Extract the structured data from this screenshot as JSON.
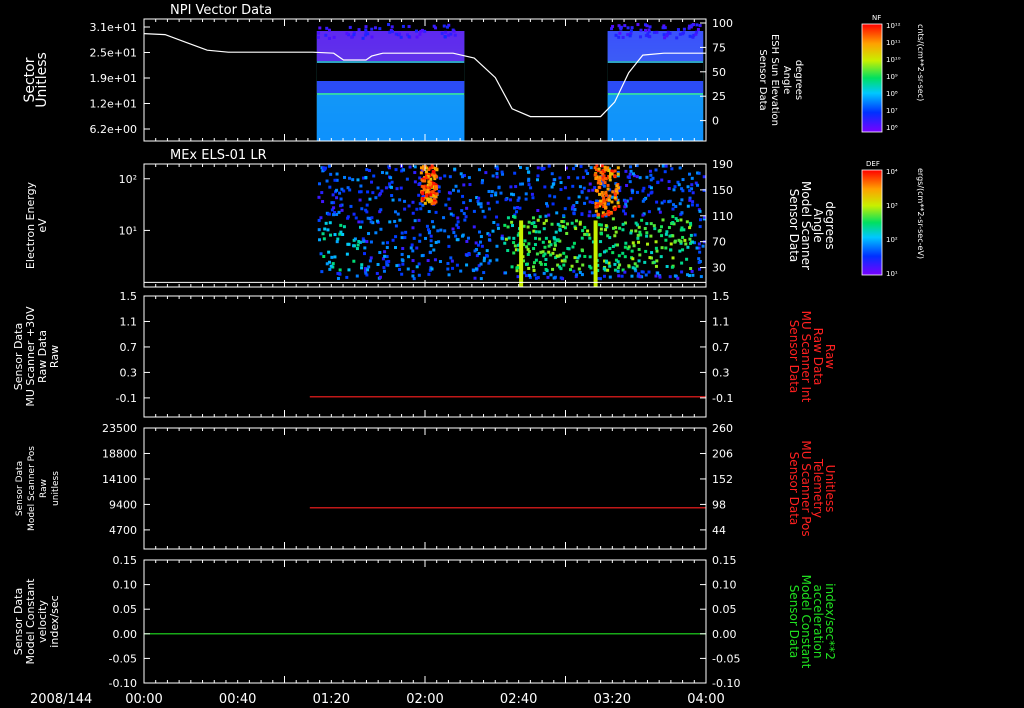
{
  "date_label": "2008/144",
  "time_ticks": [
    "00:00",
    "00:40",
    "01:20",
    "02:00",
    "02:40",
    "03:20",
    "04:00"
  ],
  "colors": {
    "text": "#ffffff",
    "red": "#ff2020",
    "green": "#20e020",
    "background": "#000000"
  },
  "colorbars": [
    {
      "label": "NF",
      "units": "cnts/(cm**2-sr-sec)",
      "tick_labels": [
        "10¹²",
        "10¹¹",
        "10¹⁰",
        "10⁹",
        "10⁸",
        "10⁷",
        "10⁶"
      ]
    },
    {
      "label": "DEF",
      "units": "ergs/(cm**2-sr-sec-eV)",
      "tick_labels": [
        "10⁴",
        "10³",
        "10²",
        "10¹"
      ]
    }
  ],
  "chart_data": [
    {
      "type": "heatmap",
      "title": "NPI Vector Data",
      "ylabel": [
        "Sector",
        "Unitless"
      ],
      "yticks": [
        "3.1e+01",
        "2.5e+01",
        "1.9e+01",
        "1.2e+01",
        "6.2e+00"
      ],
      "right_ylabel": [
        "Sensor Data",
        "ESH Sun Elevation",
        "Angle",
        "degrees"
      ],
      "right_ylim": [
        -25,
        100
      ],
      "right_yticks": [
        "100",
        "75",
        "50",
        "25",
        "0"
      ],
      "data_windows_hours": [
        [
          1.23,
          2.28
        ],
        [
          3.3,
          3.98
        ]
      ],
      "line_series": {
        "name": "ESH Sun Elevation Angle",
        "x_hours": [
          0,
          0.15,
          0.3,
          0.45,
          0.6,
          0.8,
          1.0,
          1.2,
          1.35,
          1.42,
          1.5,
          1.58,
          1.62,
          1.7,
          1.8,
          2.0,
          2.2,
          2.35,
          2.5,
          2.62,
          2.75,
          2.9,
          3.05,
          3.15,
          3.25,
          3.35,
          3.45,
          3.55,
          3.7,
          3.9,
          4.0
        ],
        "y_degrees": [
          85,
          84,
          76,
          68,
          66,
          66,
          66,
          66,
          65,
          58,
          58,
          58,
          62,
          65,
          65,
          65,
          65,
          60,
          40,
          8,
          0,
          0,
          0,
          0,
          0,
          15,
          45,
          63,
          65,
          65,
          65
        ]
      }
    },
    {
      "type": "heatmap",
      "title": "MEx ELS-01 LR",
      "ylabel": [
        "Electron Energy",
        "eV"
      ],
      "ylim": [
        1.5,
        180
      ],
      "yscale": "log",
      "yticks": [
        "10²",
        "10¹"
      ],
      "right_ylabel": [
        "Sensor Data",
        "Model Scanner",
        "Angle",
        "degrees"
      ],
      "right_yticks": [
        "190",
        "150",
        "110",
        "70",
        "30"
      ],
      "data_window_hours": [
        1.23,
        3.98
      ],
      "reference_line": {
        "y_ev": 1.8
      },
      "hotspots": [
        {
          "t_start": 1.96,
          "t_end": 2.08,
          "e_low": 40,
          "e_high": 180
        },
        {
          "t_start": 3.2,
          "t_end": 3.37,
          "e_low": 25,
          "e_high": 180
        }
      ]
    },
    {
      "type": "line",
      "ylabel": [
        "Sensor Data",
        "MU Scanner +30V",
        "Raw Data",
        "Raw"
      ],
      "ylim": [
        -0.3,
        1.5
      ],
      "yticks": [
        "1.5",
        "1.1",
        "0.7",
        "0.3",
        "-0.1"
      ],
      "right_ylabel": [
        "Sensor Data",
        "MU Scanner Int",
        "Raw Data",
        "Raw"
      ],
      "right_yticks": [
        "1.5",
        "1.1",
        "0.7",
        "0.3",
        "-0.1"
      ],
      "series": [
        {
          "x_hours": [
            1.18,
            4.0
          ],
          "y": [
            0.0,
            0.0
          ]
        }
      ]
    },
    {
      "type": "line",
      "ylabel": [
        "Sensor Data",
        "Model Scanner Pos",
        "Raw",
        "unitless"
      ],
      "ylim": [
        0,
        23500
      ],
      "yticks": [
        "23500",
        "18800",
        "14100",
        "9400",
        "4700"
      ],
      "right_ylabel": [
        "Sensor Data",
        "MU Scanner Pos",
        "Telemetry",
        "Unitless"
      ],
      "right_ylim": [
        -10,
        260
      ],
      "right_yticks": [
        "260",
        "206",
        "152",
        "98",
        "44"
      ],
      "series": [
        {
          "x_hours": [
            1.18,
            4.0
          ],
          "y": [
            8000,
            8000
          ]
        }
      ]
    },
    {
      "type": "line",
      "ylabel": [
        "Sensor Data",
        "Model Constant",
        "velocity",
        "index/sec"
      ],
      "ylim": [
        -0.1,
        0.15
      ],
      "yticks": [
        "0.15",
        "0.10",
        "0.05",
        "0.00",
        "-0.05",
        "-0.10"
      ],
      "right_ylabel": [
        "Sensor Data",
        "Model Constant",
        "acceleration",
        "index/sec**2"
      ],
      "right_yticks": [
        "0.15",
        "0.10",
        "0.05",
        "0.00",
        "-0.05",
        "-0.10"
      ],
      "series": [
        {
          "x_hours": [
            0.0,
            4.0
          ],
          "y": [
            0.0,
            0.0
          ]
        }
      ]
    }
  ]
}
